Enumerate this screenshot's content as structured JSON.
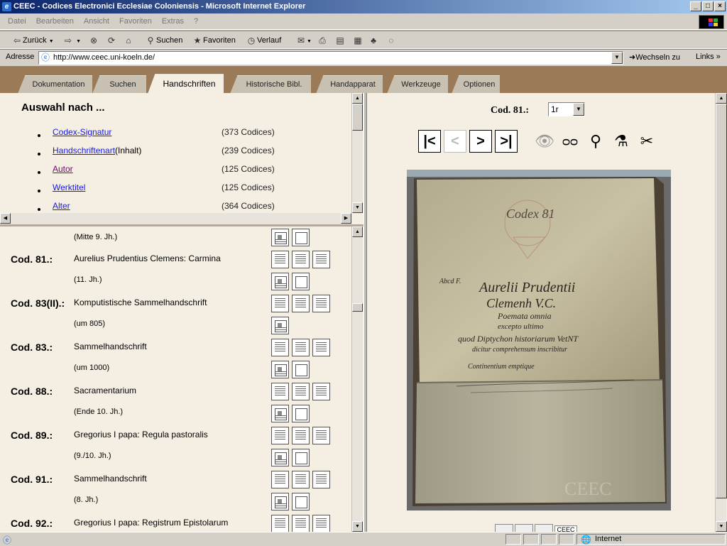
{
  "window": {
    "title": "CEEC - Codices Electronici Ecclesiae Coloniensis - Microsoft Internet Explorer",
    "buttons": {
      "minimize": "_",
      "maximize": "□",
      "close": "×"
    }
  },
  "menu": [
    "Datei",
    "Bearbeiten",
    "Ansicht",
    "Favoriten",
    "Extras",
    "?"
  ],
  "toolbar": {
    "back": "Zurück",
    "search": "Suchen",
    "favorites": "Favoriten",
    "history": "Verlauf"
  },
  "address": {
    "label": "Adresse",
    "url": "http://www.ceec.uni-koeln.de/",
    "go": "Wechseln zu",
    "links": "Links"
  },
  "tabs": [
    {
      "label": "Dokumentation"
    },
    {
      "label": "Suchen"
    },
    {
      "label": "Handschriften"
    },
    {
      "label": "Historische Bibl."
    },
    {
      "label": "Handapparat"
    },
    {
      "label": "Werkzeuge"
    },
    {
      "label": "Optionen"
    }
  ],
  "selection": {
    "heading": "Auswahl nach ...",
    "criteria": [
      {
        "link": "Codex-Signatur",
        "extra": "",
        "count": "(373 Codices)"
      },
      {
        "link": "Handschriftenart",
        "extra": " (Inhalt)",
        "count": "(239 Codices)"
      },
      {
        "link": "Autor",
        "extra": "",
        "count": "(125 Codices)"
      },
      {
        "link": "Werktitel",
        "extra": "",
        "count": "(125 Codices)"
      },
      {
        "link": "Alter",
        "extra": "",
        "count": "(364 Codices)"
      }
    ]
  },
  "codices_top_date": "(Mitte 9. Jh.)",
  "codices": [
    {
      "sig": "Cod. 81.:",
      "title": "Aurelius Prudentius Clemens: Carmina",
      "date": "(11. Jh.)"
    },
    {
      "sig": "Cod. 83(II).:",
      "title": "Komputistische Sammelhandschrift",
      "date": "(um 805)"
    },
    {
      "sig": "Cod. 83.:",
      "title": "Sammelhandschrift",
      "date": "(um 1000)"
    },
    {
      "sig": "Cod. 88.:",
      "title": "Sacramentarium",
      "date": "(Ende 10. Jh.)"
    },
    {
      "sig": "Cod. 89.:",
      "title": "Gregorius I papa: Regula pastoralis",
      "date": "(9./10. Jh.)"
    },
    {
      "sig": "Cod. 91.:",
      "title": "Sammelhandschrift",
      "date": "(8. Jh.)"
    },
    {
      "sig": "Cod. 92.:",
      "title": "Gregorius I papa: Registrum Epistolarum",
      "date": ""
    }
  ],
  "viewer": {
    "codex_label": "Cod. 81.:",
    "page": "1r",
    "manuscript": {
      "top_text": "Codex 81",
      "line1": "Aurelii Prudentii",
      "line2": "Clemenh V.C.",
      "line3": "Poemata omnia",
      "line4": "excepto ultimo",
      "line5": "quod Diptychon historiarum VetNT",
      "line6": "dicitur comprehensum inscribitur",
      "line7": "Continentium emptique",
      "margin": "Abcd F.",
      "watermark": "CEEC"
    },
    "bottom_tab": "CEEC"
  },
  "status": {
    "zone": "Internet"
  }
}
